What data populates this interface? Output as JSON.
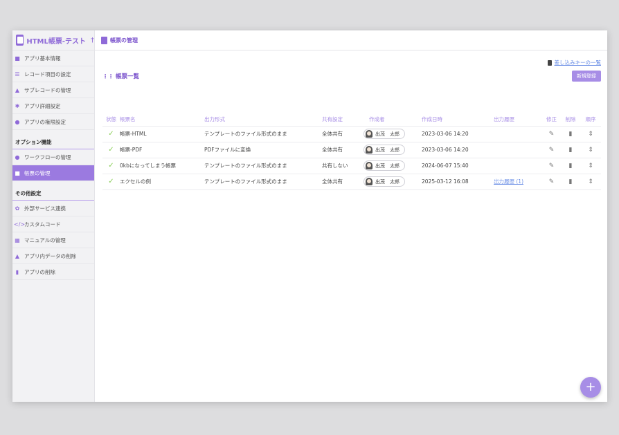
{
  "app": {
    "title": "HTML帳票-テスト",
    "pin_icon": "pin-icon"
  },
  "breadcrumb": {
    "label": "帳票の管理"
  },
  "sidebar": {
    "items": [
      {
        "label": "アプリ基本情報",
        "icon": "info-icon"
      },
      {
        "label": "レコード項目の設定",
        "icon": "list-icon"
      },
      {
        "label": "サブレコードの管理",
        "icon": "puzzle-icon"
      },
      {
        "label": "アプリ詳細設定",
        "icon": "gear-icon"
      },
      {
        "label": "アプリの権限設定",
        "icon": "users-icon"
      }
    ],
    "section_options": "オプション機能",
    "option_items": [
      {
        "label": "ワークフローの管理",
        "icon": "workflow-icon"
      },
      {
        "label": "帳票の管理",
        "icon": "document-icon",
        "active": true
      }
    ],
    "section_other": "その他設定",
    "other_items": [
      {
        "label": "外部サービス連携",
        "icon": "plugin-icon"
      },
      {
        "label": "カスタムコード",
        "icon": "code-icon"
      },
      {
        "label": "マニュアルの管理",
        "icon": "book-icon"
      },
      {
        "label": "アプリ内データの削除",
        "icon": "eraser-icon"
      },
      {
        "label": "アプリの削除",
        "icon": "trash-icon"
      }
    ]
  },
  "main": {
    "embed_link": "差し込みキーの一覧",
    "list_title": "帳票一覧",
    "new_button": "新規登録",
    "columns": [
      "状態",
      "帳票名",
      "出力形式",
      "共有設定",
      "作成者",
      "作成日時",
      "出力履歴",
      "修正",
      "削除",
      "順序"
    ],
    "rows": [
      {
        "name": "帳票-HTML",
        "format": "テンプレートのファイル形式のまま",
        "share": "全体共有",
        "creator": "出茂　太郎",
        "created": "2023-03-06 14:20",
        "history": ""
      },
      {
        "name": "帳票-PDF",
        "format": "PDFファイルに変換",
        "share": "全体共有",
        "creator": "出茂　太郎",
        "created": "2023-03-06 14:20",
        "history": ""
      },
      {
        "name": "0kbになってしまう帳票",
        "format": "テンプレートのファイル形式のまま",
        "share": "共有しない",
        "creator": "出茂　太郎",
        "created": "2024-06-07 15:40",
        "history": ""
      },
      {
        "name": "エクセルの例",
        "format": "テンプレートのファイル形式のまま",
        "share": "全体共有",
        "creator": "出茂　太郎",
        "created": "2025-03-12 16:08",
        "history": "出力履歴 (1)"
      }
    ]
  },
  "colors": {
    "accent": "#9b7ae0",
    "check": "#8ccf5b",
    "link": "#6a8ee6"
  }
}
